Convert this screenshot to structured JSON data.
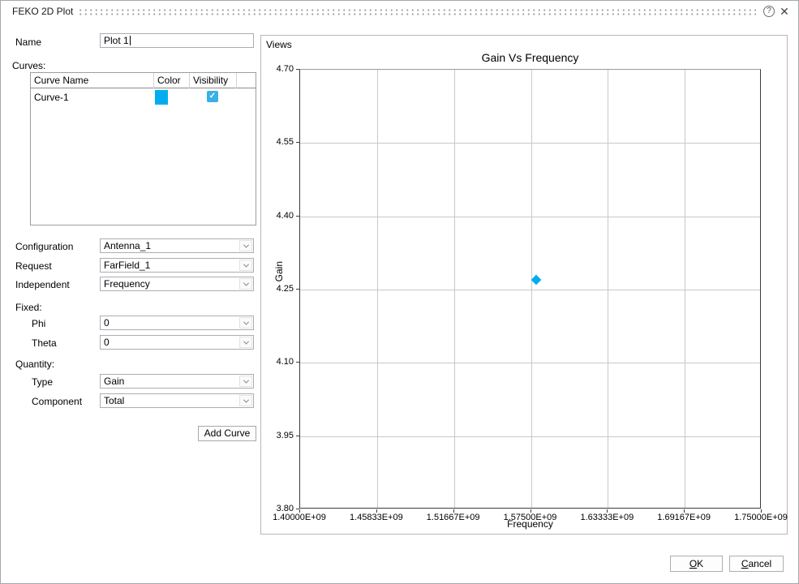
{
  "window": {
    "title": "FEKO 2D Plot"
  },
  "icons": {
    "help": "?",
    "close": "✕",
    "check": "✓"
  },
  "colors": {
    "accent": "#00aeef",
    "checkbox": "#3ab0e4",
    "grid": "#c9c9c9"
  },
  "left_panel": {
    "name_label": "Name",
    "name_value": "Plot 1",
    "curves_label": "Curves:",
    "curves_table": {
      "headers": [
        "Curve Name",
        "Color",
        "Visibility"
      ],
      "rows": [
        {
          "name": "Curve-1",
          "color": "#00aeef",
          "visible": true
        }
      ]
    },
    "configuration_label": "Configuration",
    "configuration_value": "Antenna_1",
    "request_label": "Request",
    "request_value": "FarField_1",
    "independent_label": "Independent",
    "independent_value": "Frequency",
    "fixed_label": "Fixed:",
    "phi_label": "Phi",
    "phi_value": "0",
    "theta_label": "Theta",
    "theta_value": "0",
    "quantity_label": "Quantity:",
    "type_label": "Type",
    "type_value": "Gain",
    "component_label": "Component",
    "add_curve_label": "Add Curve",
    "component_value": "Total"
  },
  "views_panel": {
    "label": "Views"
  },
  "chart_data": {
    "type": "scatter",
    "title": "Gain Vs Frequency",
    "xlabel": "Frequency",
    "ylabel": "Gain",
    "xlim": [
      1400000000,
      1750000000
    ],
    "ylim": [
      3.8,
      4.7
    ],
    "x_tick_labels": [
      "1.40000E+09",
      "1.45833E+09",
      "1.51667E+09",
      "1.57500E+09",
      "1.63333E+09",
      "1.69167E+09",
      "1.75000E+09"
    ],
    "y_tick_labels": [
      "4.70",
      "4.55",
      "4.40",
      "4.25",
      "4.10",
      "3.95",
      "3.80"
    ],
    "grid": true,
    "legend_position": "none",
    "series": [
      {
        "name": "Curve-1",
        "color": "#00aeef",
        "marker": "diamond",
        "points": [
          {
            "x": 1579000000,
            "y": 4.27
          }
        ]
      }
    ]
  },
  "footer": {
    "ok_label": "OK",
    "cancel_label": "Cancel"
  }
}
